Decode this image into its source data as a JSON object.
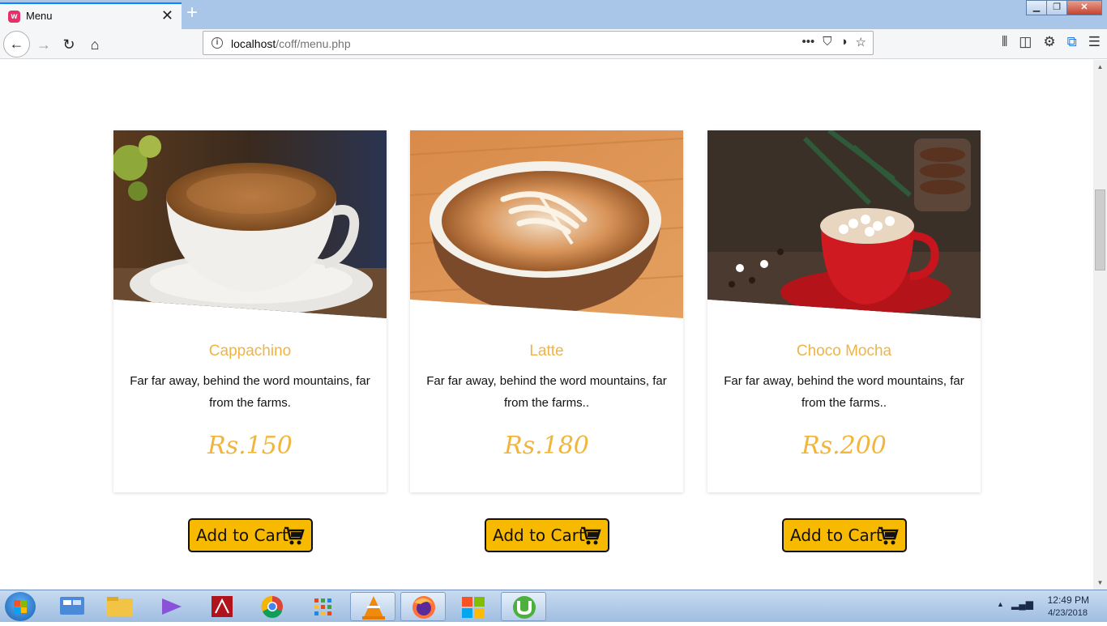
{
  "browser": {
    "tab_title": "Menu",
    "tab_favicon": "w",
    "url_host": "localhost",
    "url_path": "/coff/menu.php"
  },
  "products": [
    {
      "name": "Cappachino",
      "description": "Far far away, behind the word mountains, far from the farms.",
      "price": "Rs.150",
      "button_label": "Add to Cart"
    },
    {
      "name": "Latte",
      "description": "Far far away, behind the word mountains, far from the farms..",
      "price": "Rs.180",
      "button_label": "Add to Cart"
    },
    {
      "name": "Choco Mocha",
      "description": "Far far away, behind the word mountains, far from the farms..",
      "price": "Rs.200",
      "button_label": "Add to Cart"
    }
  ],
  "taskbar": {
    "time": "12:49 PM",
    "date": "4/23/2018"
  },
  "colors": {
    "accent": "#f0b444",
    "button": "#f8ba00"
  }
}
